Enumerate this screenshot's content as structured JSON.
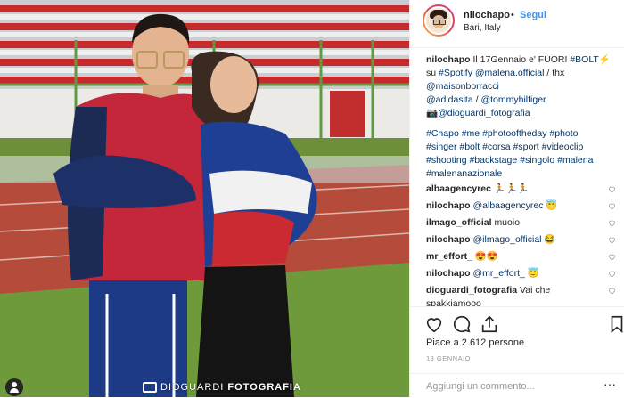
{
  "post": {
    "username": "nilochapo",
    "separator": "•",
    "follow_label": "Segui",
    "location": "Bari, Italy",
    "caption": {
      "lines": [
        [
          "Il 17Gennaio e' FUORI ",
          "#BOLT⚡"
        ],
        [
          "su ",
          "#Spotify",
          " ",
          "@malena.official",
          " / thx"
        ],
        [
          "@maisonborracci"
        ],
        [
          "@adidasita",
          " / ",
          "@tommyhilfiger"
        ],
        [
          "📷",
          "@dioguardi_fotografia"
        ]
      ],
      "hashtags": [
        [
          "#Chapo",
          " ",
          "#me",
          " ",
          "#photooftheday",
          " ",
          "#photo"
        ],
        [
          "#singer",
          " ",
          "#bolt",
          " ",
          "#corsa",
          " ",
          "#sport",
          " ",
          "#videoclip"
        ],
        [
          "#shooting",
          " ",
          "#backstage",
          " ",
          "#singolo",
          " ",
          "#malena"
        ],
        [
          "#malenanazionale"
        ]
      ]
    },
    "comments": [
      {
        "user": "albaagencyrec",
        "text": "🏃🏃🏃"
      },
      {
        "user": "nilochapo",
        "text": "@albaagencyrec 😇"
      },
      {
        "user": "ilmago_official",
        "text": "muoio"
      },
      {
        "user": "nilochapo",
        "text": "@ilmago_official 😂"
      },
      {
        "user": "mr_effort_",
        "text": "😍😍"
      },
      {
        "user": "nilochapo",
        "text": "@mr_effort_ 😇"
      },
      {
        "user": "dioguardi_fotografia",
        "text": "Vai che spakkiamooo"
      }
    ],
    "likes_prefix": "Piace a",
    "likes_count": "2.612",
    "likes_suffix": "persone",
    "date": "13 GENNAIO",
    "add_comment_placeholder": "Aggiungi un commento...",
    "more_label": "···"
  },
  "photo": {
    "credit_name": "DIOGUARDI",
    "credit_suffix": "FOTOGRAFIA"
  },
  "colors": {
    "accent": "#3897f0",
    "text": "#262626",
    "link": "#003569",
    "muted": "#999999"
  },
  "icons": [
    "heart-icon",
    "comment-icon",
    "share-icon",
    "bookmark-icon",
    "user-icon",
    "more-icon"
  ]
}
